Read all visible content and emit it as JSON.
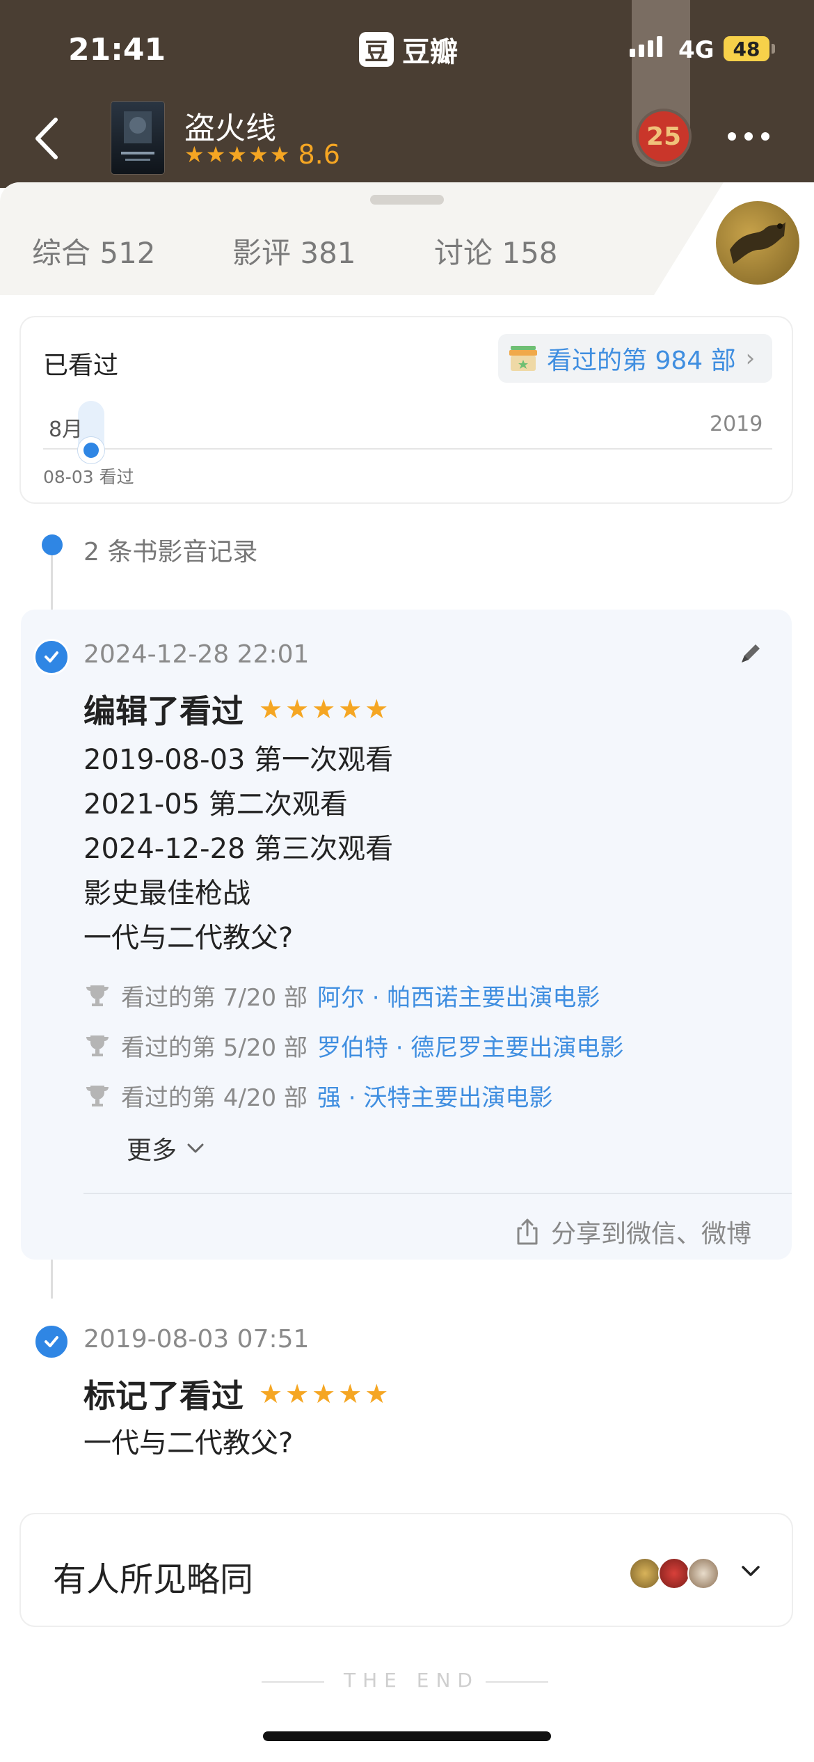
{
  "status_bar": {
    "time": "21:41",
    "app_name": "豆瓣",
    "app_logo_glyph": "豆",
    "network": "4G",
    "battery": "48"
  },
  "header": {
    "title": "盗火线",
    "stars": "★★★★★",
    "rating": "8.6",
    "notification_badge": "25"
  },
  "tabs": [
    {
      "label": "综合 512"
    },
    {
      "label": "影评 381"
    },
    {
      "label": "讨论 158"
    }
  ],
  "watched_card": {
    "title": "已看过",
    "count_label": "看过的第 984 部",
    "month": "8月",
    "year": "2019",
    "caption": "08-03 看过"
  },
  "records": {
    "count_label": "2 条书影音记录",
    "items": [
      {
        "timestamp": "2024-12-28 22:01",
        "action": "编辑了看过",
        "stars": "★★★★★",
        "notes": [
          "2019-08-03 第一次观看",
          "2021-05 第二次观看",
          "2024-12-28 第三次观看",
          "影史最佳枪战",
          "一代与二代教父?"
        ],
        "honors": [
          {
            "prefix": "看过的第 7/20 部",
            "link": "阿尔 · 帕西诺主要出演电影"
          },
          {
            "prefix": "看过的第 5/20 部",
            "link": "罗伯特 · 德尼罗主要出演电影"
          },
          {
            "prefix": "看过的第 4/20 部",
            "link": "强 · 沃特主要出演电影"
          }
        ],
        "more_label": "更多",
        "share_label": "分享到微信、微博"
      },
      {
        "timestamp": "2019-08-03 07:51",
        "action": "标记了看过",
        "stars": "★★★★★",
        "notes": [
          "一代与二代教父?"
        ]
      }
    ]
  },
  "alike": {
    "title": "有人所见略同"
  },
  "footer": {
    "end_text": "THE END"
  },
  "colors": {
    "header_bg": "#4a3e33",
    "accent_blue": "#2f86e4",
    "link_blue": "#3f8ee0",
    "star_orange": "#f5a623"
  }
}
